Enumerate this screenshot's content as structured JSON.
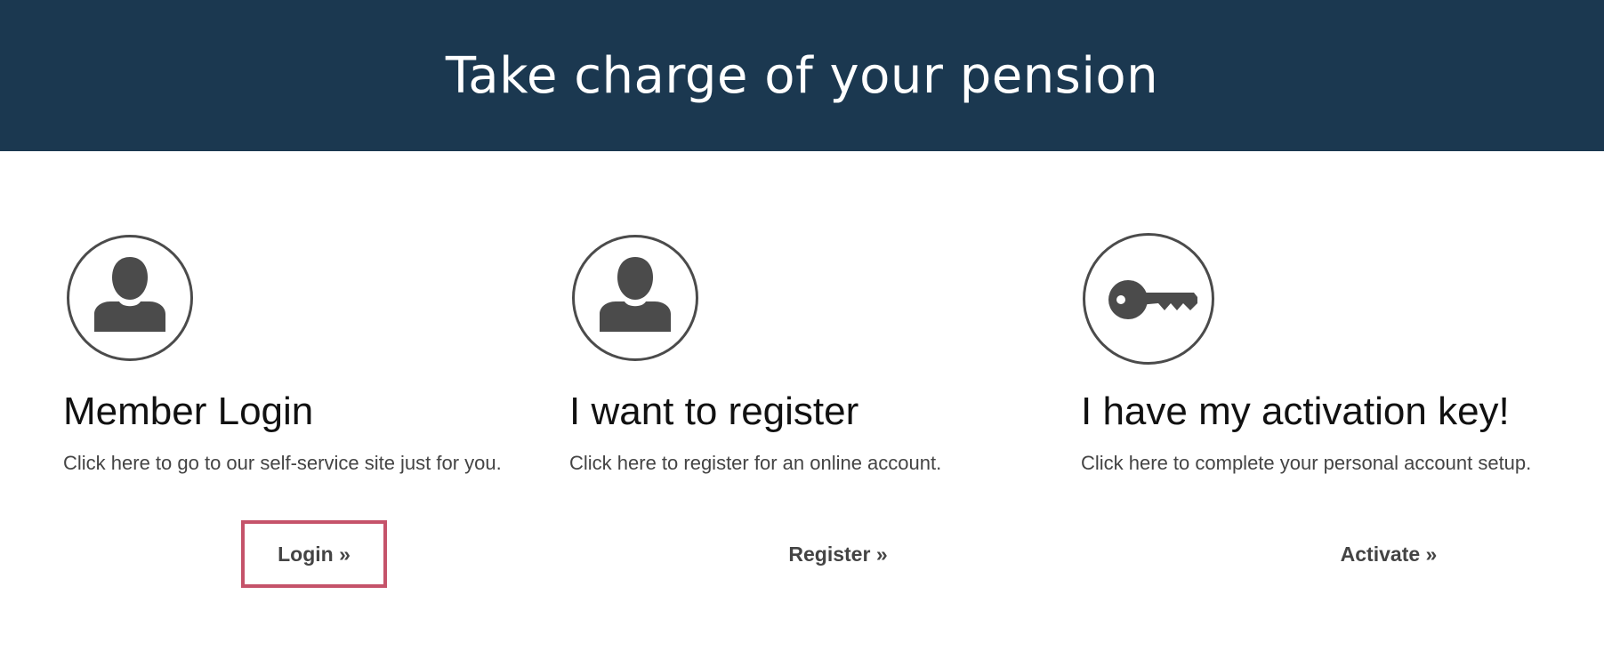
{
  "header": {
    "title": "Take charge of your pension"
  },
  "cards": [
    {
      "icon": "user-icon",
      "title": "Member Login",
      "description": "Click here to go to our self-service site just for you.",
      "action_label": "Login »"
    },
    {
      "icon": "user-icon",
      "title": "I want to register",
      "description": "Click here to register for an online account.",
      "action_label": "Register »"
    },
    {
      "icon": "key-icon",
      "title": "I have my activation key!",
      "description": "Click here to complete your personal account setup.",
      "action_label": "Activate »"
    }
  ],
  "colors": {
    "banner_background": "#1b3850",
    "icon_gray": "#4b4b4b",
    "focus_outline": "#c5536a"
  }
}
